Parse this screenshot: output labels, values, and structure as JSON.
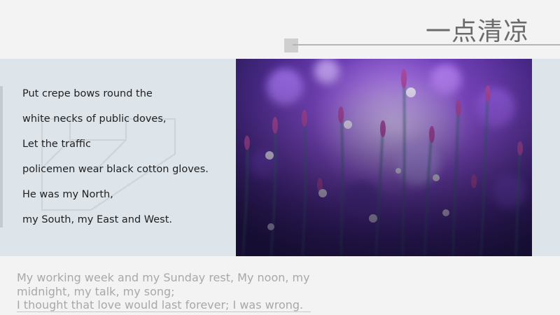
{
  "slide": {
    "title": "一点清凉",
    "poem_lines": [
      "Put crepe bows round the",
      "white necks of public doves,",
      "Let the traffic",
      "policemen wear black cotton gloves.",
      "He was my North,",
      "my South, my East and West."
    ],
    "quote_lines": [
      "My working week and my Sunday rest, My noon, my",
      "midnight, my talk, my song;",
      "I thought that love would last forever; I was wrong."
    ]
  },
  "colors": {
    "background": "#f3f3f4",
    "band": "#dde4ea",
    "title": "#6b6b6b",
    "quote": "#a8a8a8",
    "photo_accent": "#8a4fd6"
  }
}
